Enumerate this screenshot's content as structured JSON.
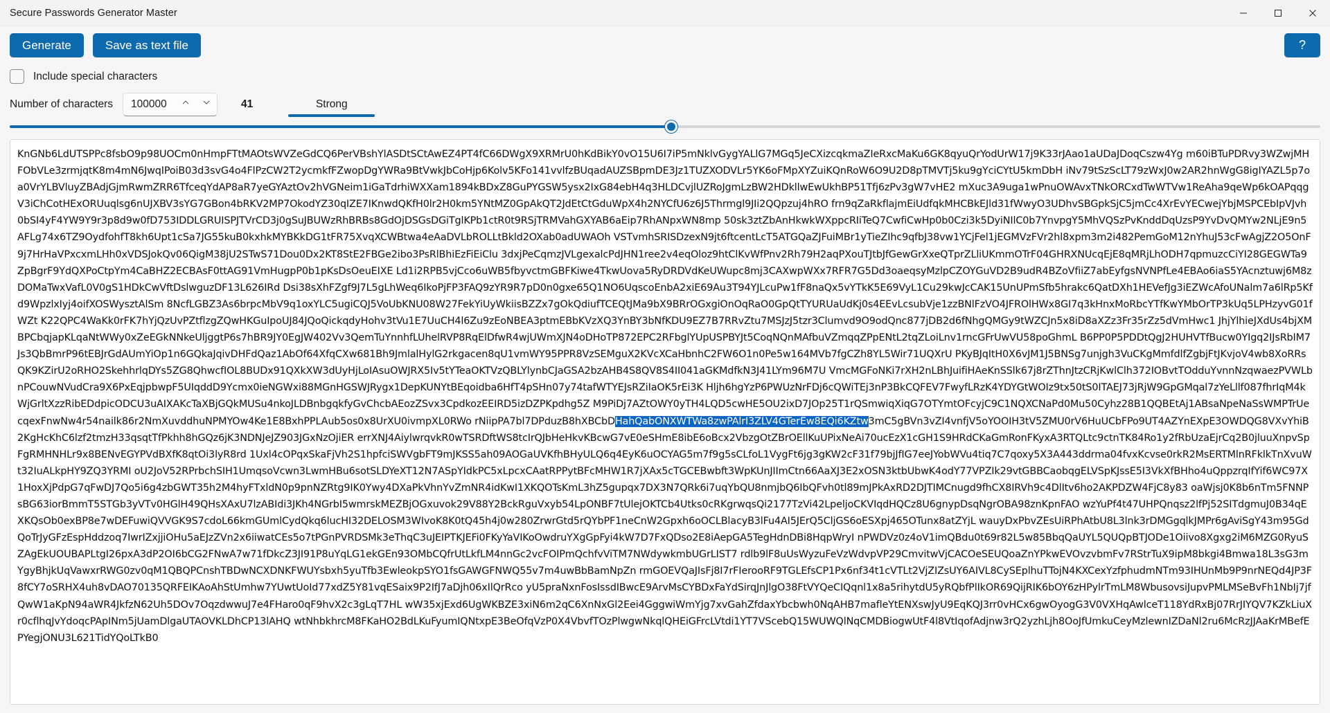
{
  "window": {
    "title": "Secure Passwords Generator Master",
    "minimize_icon": "minimize-icon",
    "maximize_icon": "maximize-icon",
    "close_icon": "close-icon"
  },
  "toolbar": {
    "generate_label": "Generate",
    "save_label": "Save as text file",
    "help_label": "?"
  },
  "options": {
    "special_chars_label": "Include special characters",
    "special_chars_checked": false
  },
  "settings": {
    "length_label": "Number of characters",
    "length_value": "100000",
    "spin_up_icon": "chevron-up-icon",
    "spin_down_icon": "chevron-down-icon",
    "strength_count": "41",
    "strength_label": "Strong",
    "accent_color": "#0d6aad"
  },
  "slider": {
    "fill_percent": 50.5,
    "thumb_percent": 50.5
  },
  "output": {
    "text_before": "KnGNb6LdUTSPPc8fsbO9p98UOCm0nHmpFTtMAOtsWVZeGdCQ6PerVBshYlASDtSCtAwEZ4PT4fC66DWgX9XRMrU0hKdBikY0vO15U6I7iP5mNklvGygYALlG7MGq5JeCXizcqkmaZIeRxcMaKu6GK8qyuQrYodUrW17j9K33rJAao1aUDaJDoqCszw4Yg m60iBTuPDRvy3WZwjMHFObVLe3zrmjqtK8m4mN6JwqIPoiB03d3svG4o4FlPzCW2T2ycmkfFZwopDgYWRa9BtVwkJbCoHjp6Kolv5KFo141vvlfzBUqadAUZSBpmDE3Jz1TUZXODVLr5YK6oFMpXYZuiKQnRoW6O9U2D8pTMVTj5ku9gYciCYtU5kmDbH iNv79tSzScLT79zWxJ0w2AR2hnWgG8igIYAZL5p7oa0VrYLBVluyZBAdjGjmRwmZRR6TfceqYdAP8aR7yeGYAztOv2hVGNeim1iGaTdrhiWXXam1894kBDxZ8GuPYGSW5ysx2IxG84ebH4q3HLDCvjlUZRoJgmLzBW2HDkllwEwUkhBP51Tfj6zPv3gW7vHE2 mXuc3A9uga1wPnuOWAvxTNkORCxdTwWTVw1ReAha9qeWp6kOAPqqgV3iChCotHExORUuqlsg6nUJXBV3sYG7GBon4bRKV2MP7OkodYZ30qIZE7IKnwdQKfH0lr2H0km5YNtMZ0GpAkQT2JdEtCtGduWpX4h2NYCfU6z6J5Thrmgl9JIi2QQpzuj4hRO frn9qZaRkflajmEiUdfqkMHCBkEJld31fWwyO3UDhvSBGpkSjC5jmCc4XrEvYECwejYbjMSPCEbIpVJvh0bSI4yF4YW9Y9r3p8d9w0fD753IDDLGRUISPJTVrCD3j0gSuJBUWzRhBRBs8GdOjDSGsDGiTglKPb1ctR0t9RSjTRMVahGXYAB6aEip7RhANpxWN8mp 50sk3ztZbAnHkwkWXppcRIiTeQ7CwfiCwHp0b0Czi3k5DyiNIlC0b7YnvpgY5MhVQSzPvKnddDqUzsP9YvDvQMYw2NLjE9n5AFLg74x6TZ9OydfohfT8kh6Upt1cSa7JG55kuB0kxhkMYBKkDG1tFR75XvqXCWBtwa4eAaDVLbROLLtBkld2OXab0adUWAOh VSTvmhSRISDzexN9jt6ftcentLcT5ATGQaZJFuiMBr1yTieZIhc9qfbJ38vw1YCjFel1jEGMVzFVr2hl8xpm3m2i482PemGoM12nYhuJ53cFwAgjZ2O5OnF9j7HrHaVPxcxmLHh0xVDSJokQv06QigM38jU2STwS71Dou0Dx2KT8StE2FBGe2ibo3PsRlBhiEzFiEiClu 3dxjPeCqmzJVLgexalcPdJHN1ree2v4eqOloz9htClKvWfPnv2Rh79H2aqPXouTJtbJfGewGrXxeQTprZLliUKmmOTrF04GHRXNUcqEjE8qMRjLhODH7qpmuzcCiYI28GEGWTa9ZpBgrF9YdQXPoCtpYm4CaBHZ2ECBAsF0ttAG91VmHugpP0b1pKsDsOeuEIXE Ld1i2RPB5vjCco6uWB5fbyvctmGBFKiwe4TkwUova5RyDRDVdKeUWupc8mj3CAXwpWXx7RFR7G5Dd3oaeqsyMzlpCZOYGuVD2B9udR4BZoVfiiZ7abEyfgsNVNPfLe4EBAo6iaS5YAcnztuwj6M8zDOMaTwxVafL0V0gS1HDkCwVftDslwguzDF13L626IRd Dsi38sXhFZgf9J7L5gLhWeq6IkoPjFP3FAQ9zYR9R7pD0n0gxe65Q1NO6UqscoEnbA2xiE69Au3T94YJLcuPw1fF8naQx5vYTkK5E69VyL1Cu29kwJcCAK15UnUPmSfb5hrakc6QatDXh1HEVefJg3iEZWcAfoUNalm7a6lRp5Kfd9WpzlxIyj4oifXOSWysztAlSm 8NcfLGBZ3As6brpcMbV9q1oxYLC5ugiCQJ5VoUbKNU08W27FekYiUyWkiisBZZx7gOkQdiufTCEQtJMa9bX9BRrOGxgiOnOqRaO0GpQtTYURUaUdKj0s4EEvLcsubVje1zzBNlFzVO4JFROlHWx8GI7q3kHnxMoRbcYTfKwYMbOrTP3kUq5LPHzyvG01fWZt K22QPC4WaKk0rFK7hYjQzUvPZtflzgZQwHKGuIpoUJ84JQoQickqdyHohv3tVu1E7UuCH4l6Zu9zEoNBEA3ptmEBbKVzXQ3YnBY3bNfKDU9EZ7B7RRvZtu7MSJzJ5tzr3Clumvd9O9odQnc877jDB2d6fNhgQMGy9tWZCJn5x8iD8aXZz3Fr35rZz5dVmHwc1 JhjYlhieJXdUs4bjXMBPCbqjapKLqaNtWWy0xZeEGkNNkeUljggtP6s7hBR9JY0EgJW402Vv3QemTuYnnhfLUhelRVP8RqElDfwR4wjUWmXJN4oDHoTP872EPC2RFbglYUpUSPBYJt5CoqNQnMAfbuVZmqqZPpENtL2tqZLoiLnv1rncGFrUwVU58poGhmL B6PP0P5PDDtQgJ2HUHVTfBucw0YIgq2IJsRbIM7Js3QbBmrP96tEBJrGdAUmYiOp1n6GQkaJqivDHFdQaz1AbOf64XfqCXw681Bh9JmlalHylG2rkgacen8qU1vmWY95PPR8VzSEMguX2KVcXCaHbnhC2FW6O1n0Pe5w164MVb7fgCZh8YL5Wir71UQXrU PKyBJqItH0X6vJM1J5BNSg7unjgh3VuCKgMmfdlfZgbjFtJKvjoV4wb8XoRRsQK9KZirU2oRHO2SkehhrlqDYs5ZG8QhwcfIOL8BUDx91QXkXW3dUyHjLoIAsuOWJRX5Iv5tYTeaOKTVzQBLYlynbCJaGSA2bzAHB4S8QV8S4II041aGKMdfkN3J41LYm96M7U VmcMGFoNKi7rXH2nLBhJuifiHAeKnSSlk67j8rZThnJtzCRjKwlClh372IOBvtTOdduYvnnNzqwaezPVWLbnPCouwNVudCra9X6PxEqjpbwpF5UIqddD9Ycmx0ieNGWxi88MGnHGSWJRygx1DepKUNYtBEqoidba6HfT4pSHn07y74tafWTYEJsRZiIaOK5rEi3K Hljh6hgYzP6PWUzNrFDj6cQWiTEj3nP3BkCQFEV7FwyfLRzK4YDYGtWOIz9tx50tS0ITAEJ73jRjW9GpGMqal7zYeLllf087fhrIqM4kWjGrltXzzRibEDdpicODCU3uAIXAKcTaXBjGQkMUSu4nkoJLDBnbgqkfyGvChcbAEozZSvx3CpdkozEEIRD5izDZPKpdhg5Z M9PiDj7AZtOWY0yTH4LQD5cwHE5OU2ixD7JOp25T1rQSmwiqXiqG7OTYmtOFcyjC9C1NQXCNaPd0Mu50Cyhz28B1QQBEtAj1ABsaNpeNaSsWMPTrUecqexFnwNw4r54nailk86r2NmXuvddhuNPMYOw4Ke1E8BxhPPLAub5os0x8UrXU0ivmpXL0RWo rNiipPA7bl7DPduzB8hXBCbD",
    "text_selected": "HahQabONXWTWa8zwPAlrI3ZLV4GTerEw8EQi6KZtw",
    "text_after": "3mC5gBVn3vZI4vnfjV5oYOOIH3tV5ZMU0rV6HuUCbFPo9UT4AZYnEXpE3OWDQG8VXvYhiB2KgHcKhC6lzf2tmzH33qsqtTfPkhh8hGQz6jK3NDNJeJZ903JGxNzOjiER errXNJ4AiylwrqvkR0wTSRDftWS8tcIrQJbHeHkvKBcwG7vE0eSHmE8ibE6oBcx2VbzgOtZBrOEllKuUPixNeAi70ucEzX1cGH1S9HRdCKaGmRonFKyxA3RTQLtc9ctnTK84Ro1y2fRbUzaEjrCq2B0jluuXnpvSpFgRMHNHLr9x8BENvEGYPVdBXfK8qtOi3lyR8rd 1Uxl4cOPqxSkaFjVh2S1hpfciSWVgbFT9mJKSS5ah09AOGaUVKfhBHyULQ6q4EyK6uOCYAG5m7f9g5sCLfoL1VygFt6jg3gKW2cF31f79bjJfIG7eeJYobWVu4tiq7C7qoxy5X3A443ddrma04fvxKcvse0rkR2MsERTMlnRFklkTnXvuWt32IuALkpHY9ZQ3YRMI oU2JoV52RPrbchSIH1UmqsoVcwn3LwmHBu6sotSLDYeXT12N7ASpYIdkPC5xLpcxCAatRPPytBFcMHW1R7jXAx5cTGCEBwbft3WpKUnJIImCtn66AaXJ3E2xOSN3ktbUbwK4odY77VPZIk29vtGBBCaobqgELVSpKJssE5I3VkXfBHho4uQppzrqIfYif6WC97X 1HoxXjPdpG7qFwDJ7Qo5i6g4zbGWT35h2M4hyFTxldN0p9pnNZRtg9IK0Ywy4DXaPkVhnYvZmNR4idKwI1XKQOTsKmL3hZ5gupqx7DX3N7QRk6i7uqYbQU8nmjbQ6IbQFvh0tl89mJPkAxRD2DJTIMCnugd9fhCX8IRVh9c4DlItv6ho2AKPDZW4FjC8y83 oaWjsj0K8b6nTm5FNNPsBG63iorBmmT5STGb3yVTv0HGlH49QHsXAxU7lzABIdi3JKh4NGrbI5wmrskMEZBjOGxuvok29V88Y2BckRguVxyb54LpONBF7tUlejOKTCb4Utks0cRKgrwqsQi2177TzVi42LpeljoCKVIqdHQCz8U6gnypDsqNgrOBA98znKpnFAO wzYuPf4t47UHPQnqsz2lfPj52SITdgmuJ0B34qEXKQsOb0exBP8e7wDEFuwiQVVGK9S7cdoL66kmGUmlCydQkq6lucHI32DELOSM3WIvoK8K0tQ45h4j0w280ZrwrGtd5rQYbPF1neCnW2Gpxh6oOCLBlacyB3lFu4AI5JErQ5CljGS6oESXpj465OTunx8atZYjL wauyDxPbvZEsUiRPhAtbU8L3lnk3rDMGgqlkJMPr6gAviSgY43m95GdQoTrJyGFzEspHddzoq7IwrIZxjjiOHu5aEJzZVn2x6iiwatCEs5o7tPGnPVRDSMk3eThqC3uJEIPTKJEFi0FKyYaVIKoOwdruYXgGpFyi4kW7D7FxQDso2E8iAepGA5TegHdnDBi8HqpWryI nPWDVz0z4oV1imQBdu0t69r82L5w85BbqQaUYL5QUQpBTJODe1Oiivo8Xgxg2iM6MZG0RyuSZAgEkUOUBAPLtgI26pxA3dP2OI6bCG2FNwA7w71fDkcZ3JI91P8uYqLG1ekGEn93OMbCQfrUtLkfLM4nnGc2vcFOIPmQchfvViTM7NWdywkmbUGrLIST7 rdlb9lF8uUsWyzuFeVzWdvpVP29CmvitwVjCACOeSEUQoaZnYPkwEVOvzvbmFv7RStrTuX9ipM8bkgi4Bmwa18L3sG3mYgyBhjkUqVawxrRWG0zv0qM1QBQPCnshTBDwNCXDNKFWUYsbxh5yuTfb3EwleokpSYO1fsGAWGFNWQ55v7m4uwBbBamNpZn rmGOEVQaJIsFj8I7rFIerooRF9TGLEfsCP1Px6nf34t1cVTLt2VjZIZsUY6AIVL8CySEplhuTTojN4KXCexYzfphudmNTm93IHUnMb9P9nrNEQd4JP3F8fCY7oSRHX4uh8vDAO70135QRFEIKAoAhStUmhw7YUwtUoId77xdZ5Y81vqESaix9P2IfJ7aDjh06xIlQrRco yU5praNxnFosIssdIBwcE9ArvMsCYBDxFaYdSirqJnJlgO38FtVYQeCIQqnl1x8a5rihytdU5yRQbfPlIkOR69QijRIK6bOY6zHPylrTmLM8WbusovsiJupvPMLMSeBvFh1NbIj7jfQwW1aKpN94aWR4JkfzN62Uh5DOv7OqzdwwuJ7e4FHaro0qF9hvX2c3gLqT7HL wW35xjExd6UgWKBZE3xiN6m2qC6XnNxGl2Eei4GggwiWmYjg7xvGahZfdaxYbcbwh0NqAHB7mafleYtENXswJyU9EqKQJ3rr0vHCx6gwOyogG3V0VXHqAwlceT118YdRxBj07RrJIYQV7KZkLiuXr0cflhqJvYdoqcPApINm5jUamDlgaUTAOVKLDhCP13lAHQ wtNhbkhrcM8FKaHO2BdLKuFyumIQNtxpE3BeOfqVzP0X4VbvfTOzPlwgwNkqlQHEiGFrcLVtdi1YT7VScebQ15WUWQlNqCMDBiogwUtF4l8VtIqofAdjnw3rQ2yzhLjh8OoJfUmkuCeyMzlewnIZDaNl2ru6McRzJJAaKrMBefEPYegjONU3L621TidYQoLTkB0"
  }
}
